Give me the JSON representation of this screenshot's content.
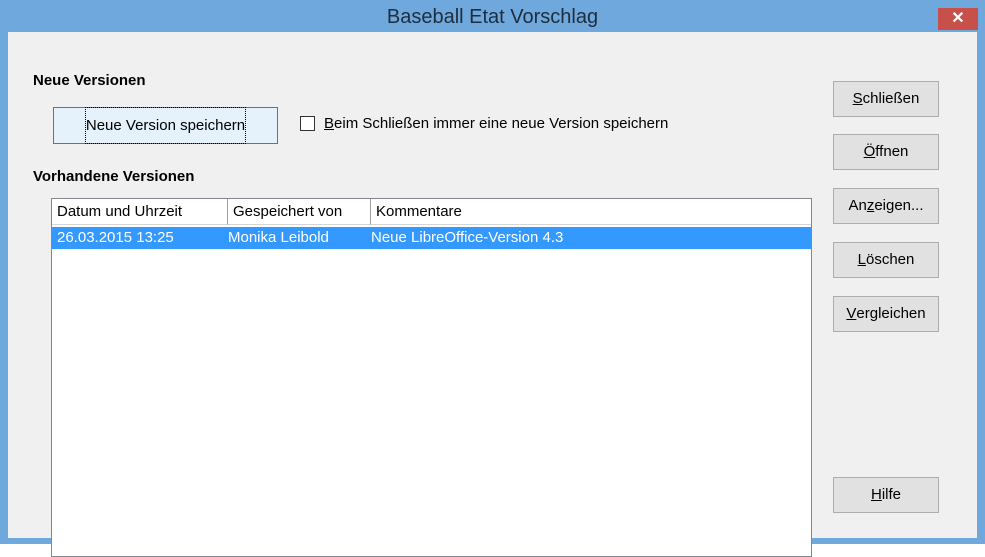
{
  "window": {
    "title": "Baseball Etat Vorschlag",
    "close_glyph": "✕"
  },
  "sections": {
    "new_versions": "Neue Versionen",
    "existing_versions": "Vorhandene Versionen"
  },
  "buttons": {
    "save_new_version": "Neue Version speichern",
    "close": {
      "pre": "",
      "key": "S",
      "post": "chließen"
    },
    "open": {
      "pre": "",
      "key": "Ö",
      "post": "ffnen"
    },
    "show": {
      "pre": "An",
      "key": "z",
      "post": "eigen..."
    },
    "delete": {
      "pre": "",
      "key": "L",
      "post": "öschen"
    },
    "compare": {
      "pre": "",
      "key": "V",
      "post": "ergleichen"
    },
    "help": {
      "pre": "",
      "key": "H",
      "post": "ilfe"
    }
  },
  "checkbox": {
    "key": "B",
    "label_rest": "eim Schließen immer eine neue Version speichern",
    "checked": false
  },
  "table": {
    "columns": [
      "Datum und Uhrzeit",
      "Gespeichert von",
      "Kommentare"
    ],
    "rows": [
      {
        "date": "26.03.2015 13:25",
        "saved_by": "Monika Leibold",
        "comment": "Neue LibreOffice-Version 4.3",
        "selected": true
      }
    ]
  },
  "colors": {
    "titlebar": "#6fa8dc",
    "close": "#c7504b",
    "selection": "#3399ff",
    "dialog_bg": "#f0f0f0"
  }
}
